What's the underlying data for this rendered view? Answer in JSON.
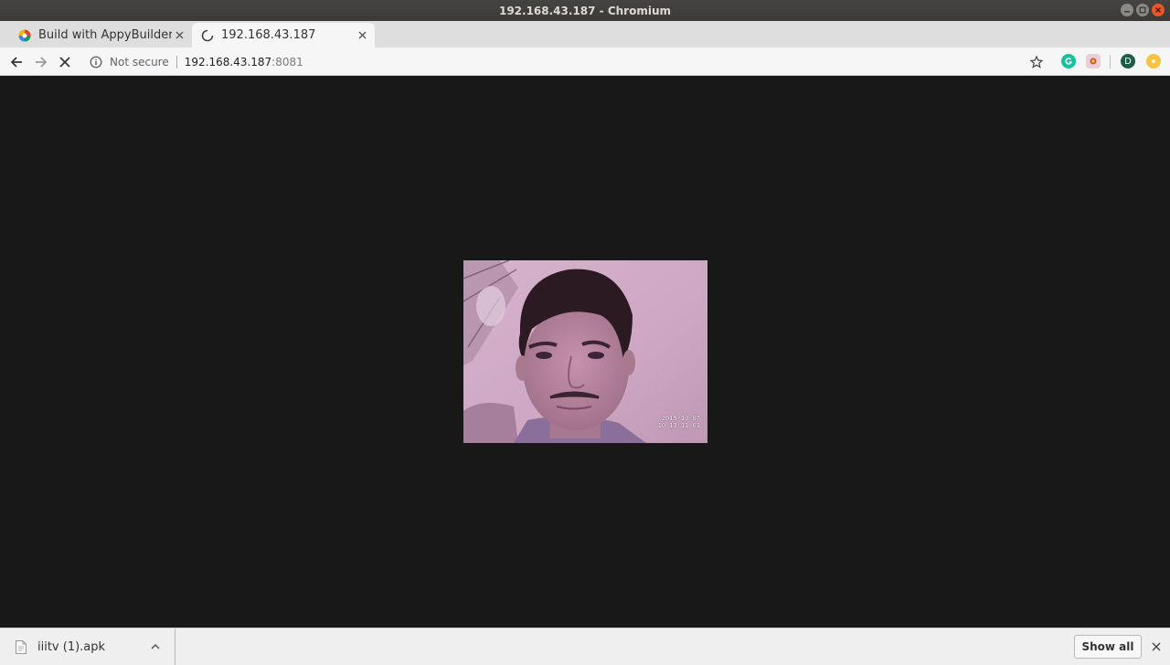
{
  "window": {
    "title": "192.168.43.187 - Chromium"
  },
  "tabs": [
    {
      "label": "Build with AppyBuilder!",
      "icon": "appybuilder-favicon",
      "active": false
    },
    {
      "label": "192.168.43.187",
      "icon": "loading-spinner-icon",
      "active": true
    }
  ],
  "toolbar": {
    "security_label": "Not secure",
    "url_host": "192.168.43.187",
    "url_port": ":8081",
    "extensions": [
      "grammarly-icon",
      "extension-icon",
      "profile-avatar",
      "notification-extension-icon"
    ],
    "profile_initial": "D"
  },
  "stream": {
    "overlay_date": "2019-10-07",
    "overlay_time": "10:13:11 01"
  },
  "download_bar": {
    "file_name": "iiitv (1).apk",
    "show_all_label": "Show all"
  },
  "colors": {
    "page_background": "#181818",
    "chrome_titlebar": "#3b3a37",
    "grammarly_green": "#15c39a",
    "profile_green": "#1e5c4a"
  }
}
